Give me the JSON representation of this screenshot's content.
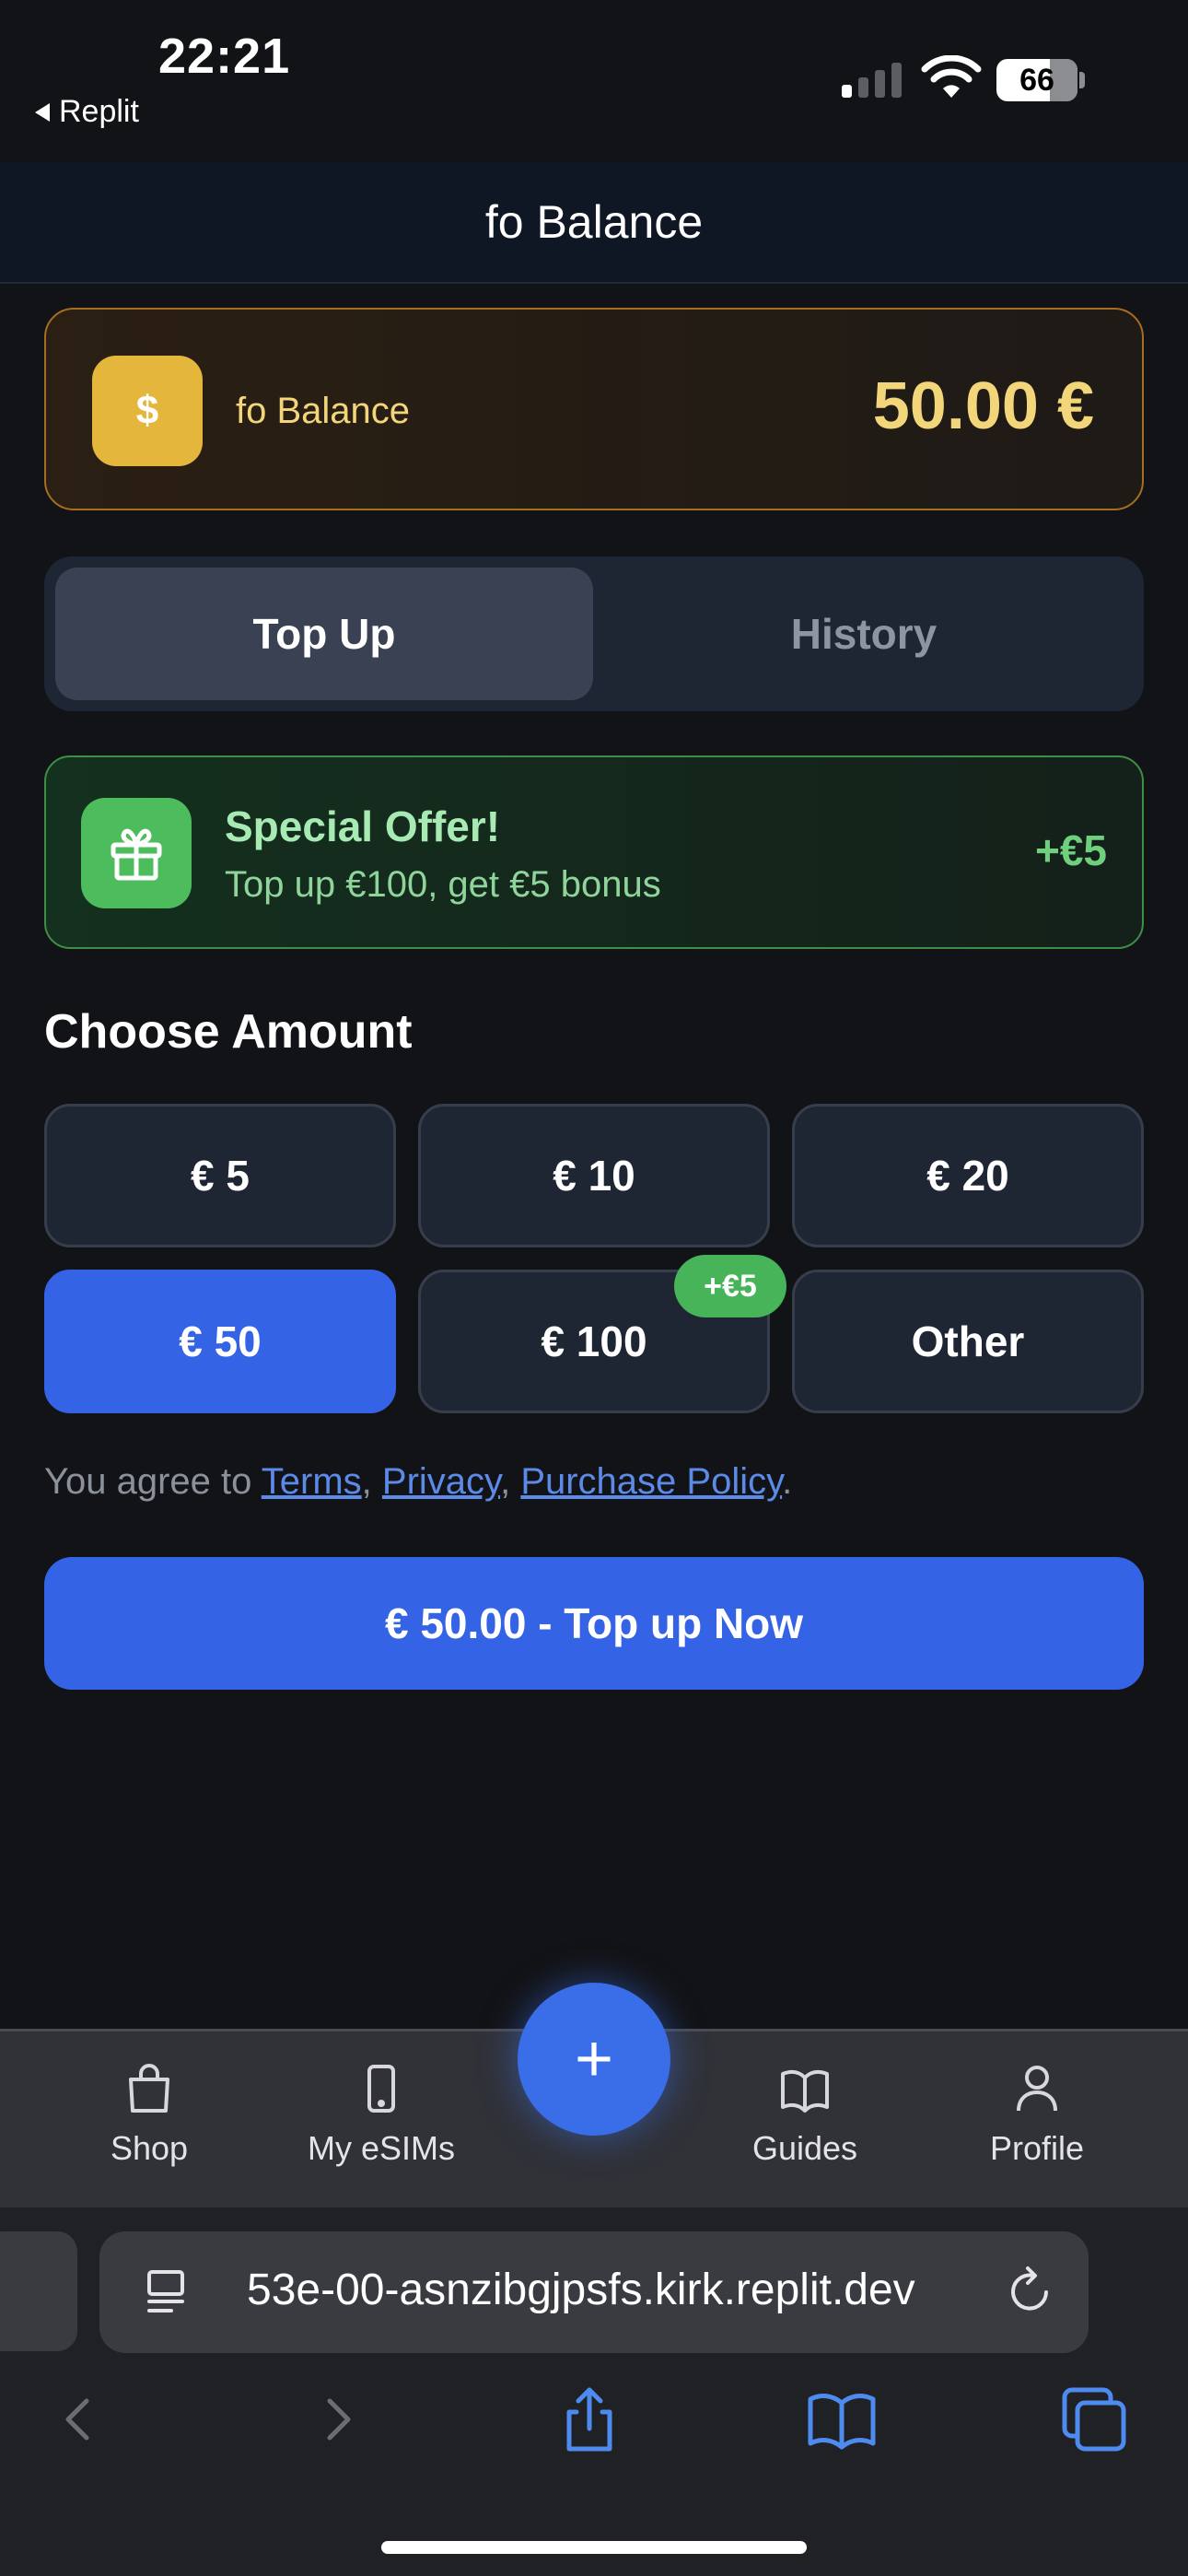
{
  "status_bar": {
    "time": "22:21",
    "back_label": "Replit",
    "battery": "66"
  },
  "header": {
    "title": "fo Balance"
  },
  "balance": {
    "label": "fo Balance",
    "amount": "50.00 €",
    "icon": "$"
  },
  "tabs": [
    {
      "label": "Top Up",
      "active": true
    },
    {
      "label": "History",
      "active": false
    }
  ],
  "offer": {
    "title": "Special Offer!",
    "subtitle": "Top up €100, get €5 bonus",
    "bonus": "+€5",
    "icon": "gift-icon"
  },
  "choose": {
    "title": "Choose Amount",
    "amounts": [
      {
        "label": "€ 5",
        "selected": false
      },
      {
        "label": "€ 10",
        "selected": false
      },
      {
        "label": "€ 20",
        "selected": false
      },
      {
        "label": "€ 50",
        "selected": true
      },
      {
        "label": "€ 100",
        "selected": false,
        "badge": "+€5"
      },
      {
        "label": "Other",
        "selected": false
      }
    ]
  },
  "terms": {
    "prefix": "You agree to ",
    "terms": "Terms",
    "sep1": ", ",
    "privacy": "Privacy",
    "sep2": ", ",
    "purchase": "Purchase Policy",
    "suffix": "."
  },
  "cta": {
    "label": "€ 50.00 - Top up Now"
  },
  "nav": {
    "items": [
      {
        "label": "Shop",
        "icon": "shopping-bag-icon"
      },
      {
        "label": "My eSIMs",
        "icon": "phone-icon"
      },
      {
        "label": "Guides",
        "icon": "book-icon"
      },
      {
        "label": "Profile",
        "icon": "user-icon"
      }
    ],
    "fab": "+"
  },
  "browser": {
    "url": "53e-00-asnzibgjpsfs.kirk.replit.dev"
  },
  "colors": {
    "accent": "#3563e5",
    "gold": "#f4d67a",
    "green": "#6ed07d",
    "background": "#121316"
  }
}
